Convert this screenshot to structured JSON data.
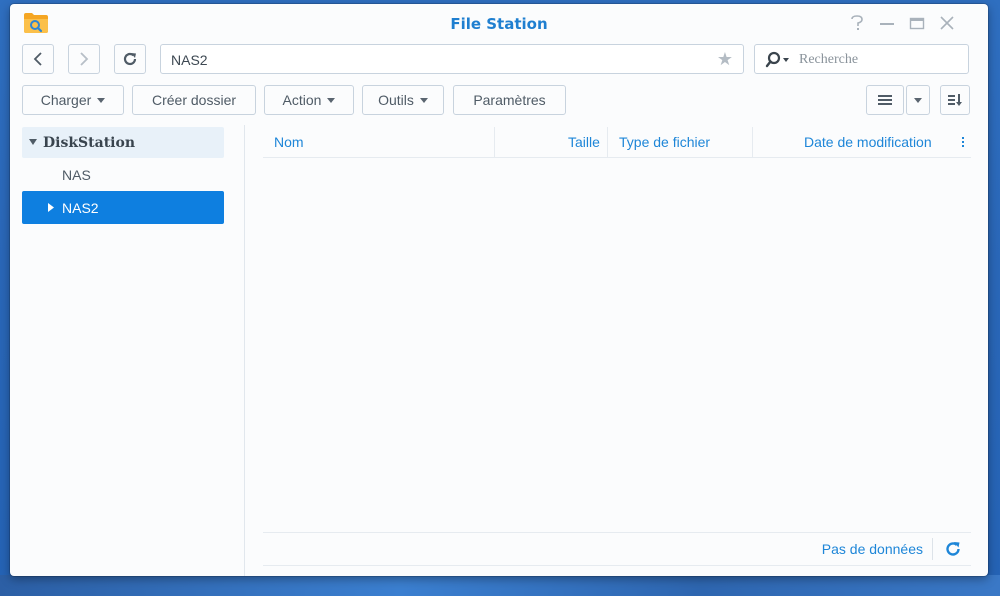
{
  "window": {
    "title": "File Station",
    "controls": [
      "help-icon",
      "minimize-icon",
      "maximize-icon",
      "close-icon"
    ]
  },
  "toolbar": {
    "back_icon": "chevron-left-icon",
    "forward_icon": "chevron-right-icon",
    "refresh_icon": "refresh-icon",
    "path": "NAS2",
    "favorite_icon": "star-icon",
    "search_placeholder": "Recherche",
    "search_icon": "search-icon"
  },
  "actions": {
    "upload": "Charger",
    "create_folder": "Créer dossier",
    "action": "Action",
    "tools": "Outils",
    "settings": "Paramètres"
  },
  "view": {
    "list_icon": "list-view-icon",
    "dropdown_icon": "caret-down-icon",
    "sort_icon": "sort-icon"
  },
  "tree": {
    "root": "DiskStation",
    "items": [
      {
        "label": "NAS",
        "selected": false
      },
      {
        "label": "NAS2",
        "selected": true
      }
    ]
  },
  "grid": {
    "columns": {
      "name": "Nom",
      "size": "Taille",
      "type": "Type de fichier",
      "modified": "Date de modification"
    },
    "rows": [],
    "footer_status": "Pas de données"
  },
  "colors": {
    "accent": "#1e86d8",
    "selected_bg": "#0e7fe0",
    "title": "#1f7fd0"
  }
}
